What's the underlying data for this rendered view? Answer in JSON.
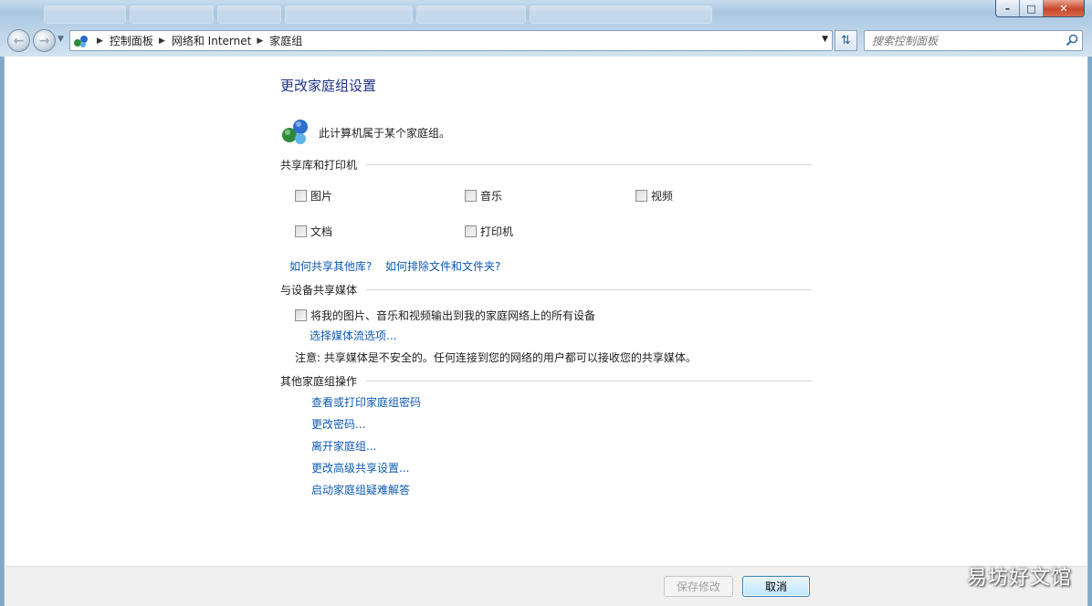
{
  "breadcrumb": {
    "items": [
      "控制面板",
      "网络和 Internet",
      "家庭组"
    ]
  },
  "search": {
    "placeholder": "搜索控制面板"
  },
  "page": {
    "title": "更改家庭组设置",
    "member_text": "此计算机属于某个家庭组。"
  },
  "share_section": {
    "header": "共享库和打印机",
    "items": [
      {
        "label": "图片",
        "checked": false
      },
      {
        "label": "音乐",
        "checked": false
      },
      {
        "label": "视频",
        "checked": false
      },
      {
        "label": "文档",
        "checked": false
      },
      {
        "label": "打印机",
        "checked": false
      }
    ],
    "link_share_other": "如何共享其他库?",
    "link_exclude": "如何排除文件和文件夹?"
  },
  "media_section": {
    "header": "与设备共享媒体",
    "stream_label": "将我的图片、音乐和视频输出到我的家庭网络上的所有设备",
    "stream_checked": false,
    "stream_options_link": "选择媒体流选项...",
    "note": "注意: 共享媒体是不安全的。任何连接到您的网络的用户都可以接收您的共享媒体。"
  },
  "other_section": {
    "header": "其他家庭组操作",
    "links": [
      "查看或打印家庭组密码",
      "更改密码...",
      "离开家庭组...",
      "更改高级共享设置...",
      "启动家庭组疑难解答"
    ]
  },
  "footer": {
    "save_label": "保存修改",
    "cancel_label": "取消"
  },
  "watermark": "易坊好文馆",
  "colors": {
    "link": "#0e59b5",
    "title": "#1e3287"
  }
}
